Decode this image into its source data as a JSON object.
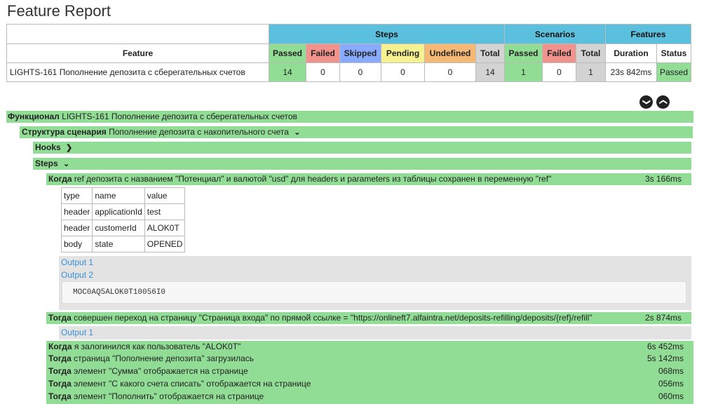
{
  "title": "Feature Report",
  "summary": {
    "group_steps": "Steps",
    "group_scenarios": "Scenarios",
    "group_features": "Features",
    "col_feature": "Feature",
    "col_passed": "Passed",
    "col_failed": "Failed",
    "col_skipped": "Skipped",
    "col_pending": "Pending",
    "col_undefined": "Undefined",
    "col_total": "Total",
    "col_sc_passed": "Passed",
    "col_sc_failed": "Failed",
    "col_sc_total": "Total",
    "col_duration": "Duration",
    "col_status": "Status",
    "row": {
      "feature": "LIGHTS-161 Пополнение депозита с сберегательных счетов",
      "passed": "14",
      "failed": "0",
      "skipped": "0",
      "pending": "0",
      "undefined": "0",
      "total": "14",
      "sc_passed": "1",
      "sc_failed": "0",
      "sc_total": "1",
      "duration": "23s 842ms",
      "status": "Passed"
    }
  },
  "controls": {
    "collapse_all": "collapse-all",
    "expand_all": "expand-all"
  },
  "feature": {
    "keyword": "Функционал",
    "name": "LIGHTS-161 Пополнение депозита с сберегательных счетов"
  },
  "scenario": {
    "keyword": "Структура сценария",
    "name": "Пополнение депозита с накопительного счета"
  },
  "hooks": {
    "label": "Hooks"
  },
  "steps": {
    "label": "Steps"
  },
  "step1": {
    "keyword": "Когда",
    "text": "ref депозита с названием \"Потенциал\" и валютой \"usd\" для headers и parameters из таблицы сохранен в переменную \"ref\"",
    "duration": "3s 166ms",
    "table": [
      [
        "type",
        "name",
        "value"
      ],
      [
        "header",
        "applicationId",
        "test"
      ],
      [
        "header",
        "customerId",
        "ALOK0T"
      ],
      [
        "body",
        "state",
        "OPENED"
      ]
    ],
    "output1": "Output 1",
    "output2": "Output 2",
    "code": "MOC0AQ5ALOK0T10056I0"
  },
  "step2": {
    "keyword": "Тогда",
    "text": "совершен переход на страницу \"Страница входа\" по прямой ссылке = \"https://onlineft7.alfaintra.net/deposits-refilling/deposits/{ref}/refill\"",
    "duration": "2s 874ms",
    "output1": "Output 1"
  },
  "more_steps": [
    {
      "keyword": "Когда",
      "text": "я залогинился как пользователь \"ALOK0T\"",
      "duration": "6s 452ms"
    },
    {
      "keyword": "Тогда",
      "text": "страница \"Пополнение депозита\" загрузилась",
      "duration": "5s 142ms"
    },
    {
      "keyword": "Тогда",
      "text": "элемент \"Сумма\" отображается на странице",
      "duration": "068ms"
    },
    {
      "keyword": "Тогда",
      "text": "элемент \"С какого счета списать\" отображается на странице",
      "duration": "056ms"
    },
    {
      "keyword": "Тогда",
      "text": "элемент \"Пополнить\" отображается на странице",
      "duration": "060ms"
    }
  ],
  "colors": {
    "passed": "#92dd96",
    "header": "#5bc0de",
    "link": "#3a8fd8"
  }
}
